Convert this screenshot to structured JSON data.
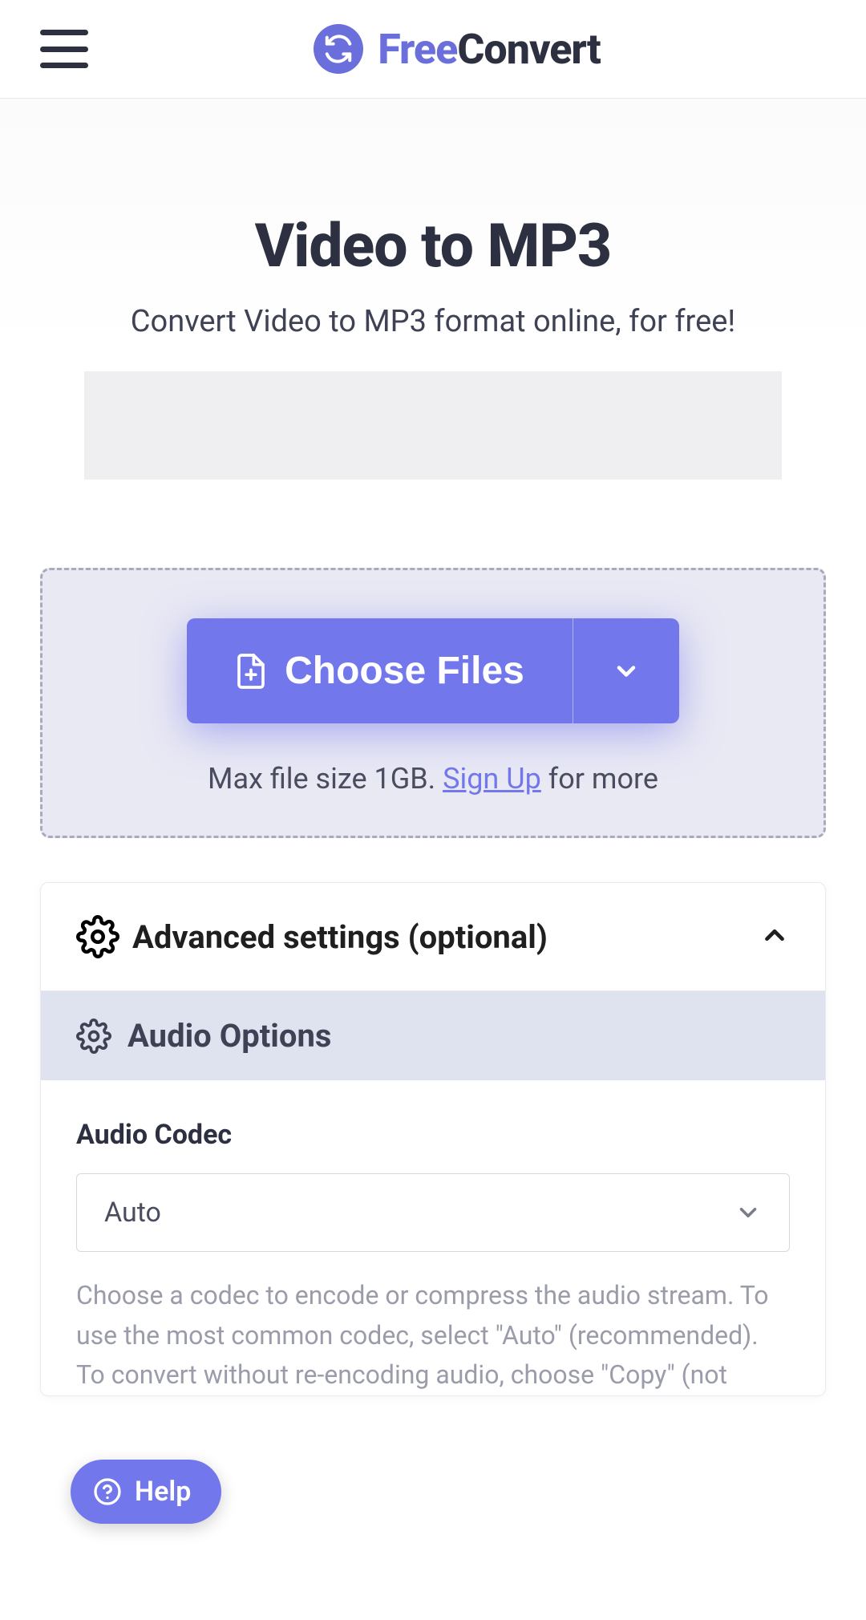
{
  "header": {
    "brand_free": "Free",
    "brand_convert": "Convert"
  },
  "hero": {
    "title": "Video to MP3",
    "subtitle": "Convert Video to MP3 format online, for free!"
  },
  "dropzone": {
    "choose_label": "Choose Files",
    "max_prefix": "Max file size 1GB. ",
    "signup": "Sign Up",
    "max_suffix": " for more"
  },
  "settings": {
    "advanced_label": "Advanced settings (optional)",
    "audio_options_label": "Audio Options",
    "codec": {
      "label": "Audio Codec",
      "value": "Auto",
      "hint": "Choose a codec to encode or compress the audio stream. To use the most common codec, select \"Auto\" (recommended). To convert without re-encoding audio, choose \"Copy\" (not"
    }
  },
  "help": {
    "label": "Help"
  }
}
